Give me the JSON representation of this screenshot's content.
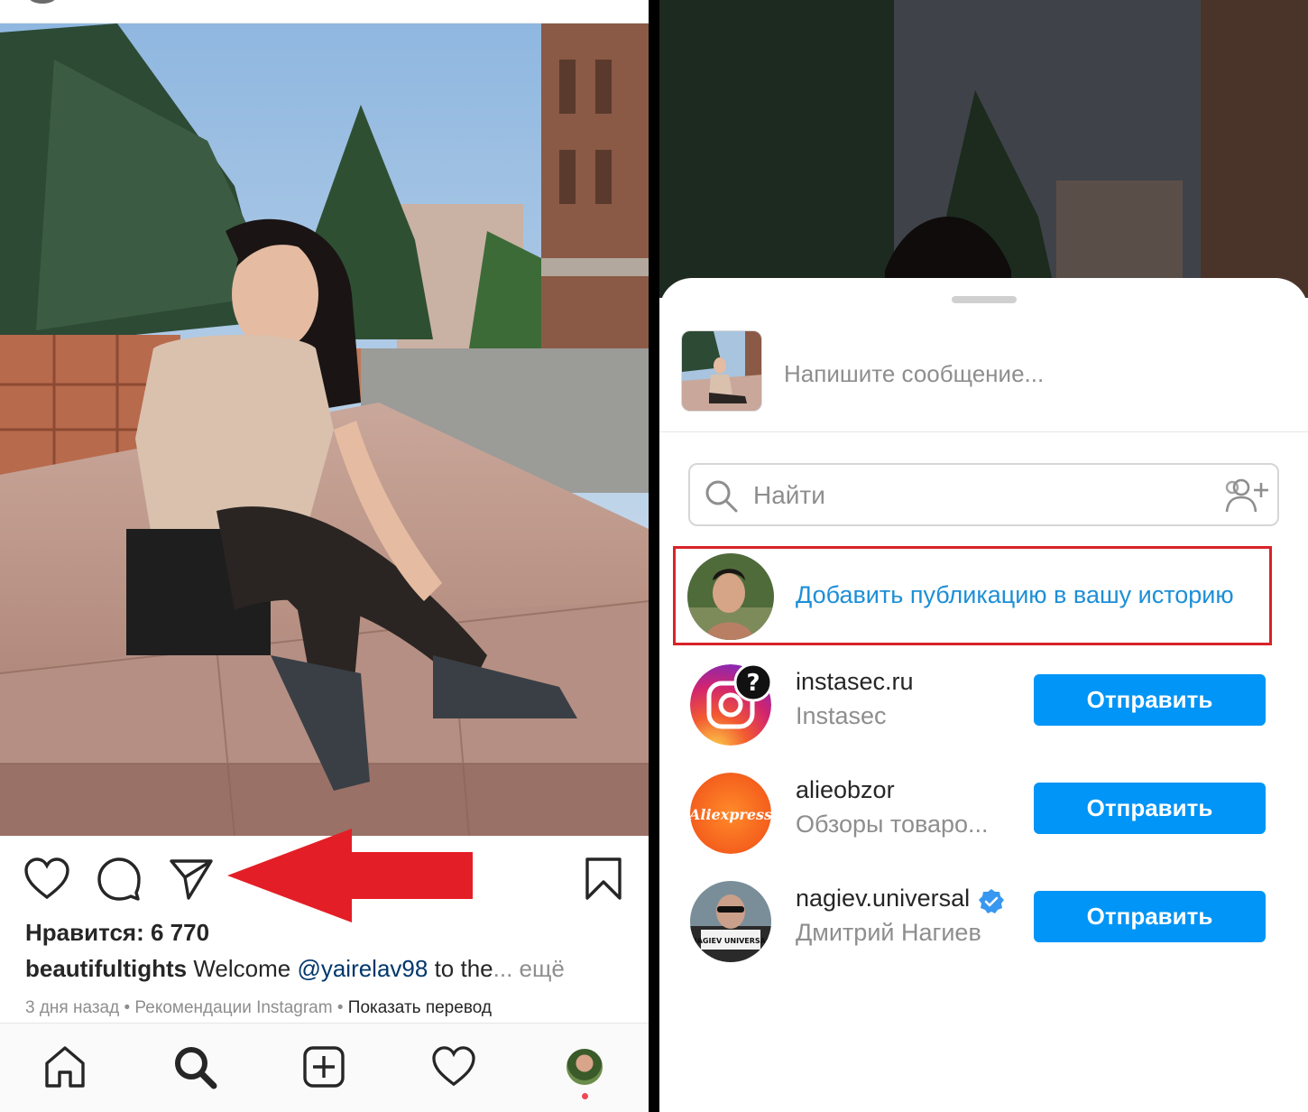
{
  "left": {
    "likes_text": "Нравится: 6 770",
    "caption": {
      "username": "beautifultights",
      "text_start": " Welcome ",
      "mention": "@yairelav98",
      "text_end": " to the",
      "ellipsis": "...",
      "more": " ещё"
    },
    "meta": {
      "time": "3 дня назад",
      "dot1": " • ",
      "source": "Рекомендации Instagram",
      "dot2": " • ",
      "translate": "Показать перевод"
    },
    "icons": {
      "like": "heart-icon",
      "comment": "comment-icon",
      "share": "paper-plane-icon",
      "save": "bookmark-icon",
      "annotation": "red-arrow"
    },
    "tabs": [
      "home-icon",
      "search-icon",
      "new-post-icon",
      "activity-icon",
      "profile-avatar"
    ],
    "accent_colors": {
      "arrow": "#e41e26",
      "notification_dot": "#ed4956"
    }
  },
  "right": {
    "message_placeholder": "Напишите сообщение...",
    "search_placeholder": "Найти",
    "add_story_label": "Добавить публикацию в вашу историю",
    "contacts": [
      {
        "username": "instasec.ru",
        "fullname": "Instasec",
        "button": "Отправить"
      },
      {
        "username": "alieobzor",
        "fullname": "Обзоры товаро...",
        "button": "Отправить"
      },
      {
        "username": "nagiev.universal",
        "fullname": "Дмитрий Нагиев",
        "button": "Отправить",
        "verified": true
      }
    ],
    "avatar_texts": {
      "aliexpress": "Aliexpress",
      "nagiev_sign": "NAGIEV UNIVERSAL"
    },
    "colors": {
      "send_button": "#0095f6",
      "story_link": "#1d8fd6",
      "highlight_box": "#d8232a"
    }
  }
}
